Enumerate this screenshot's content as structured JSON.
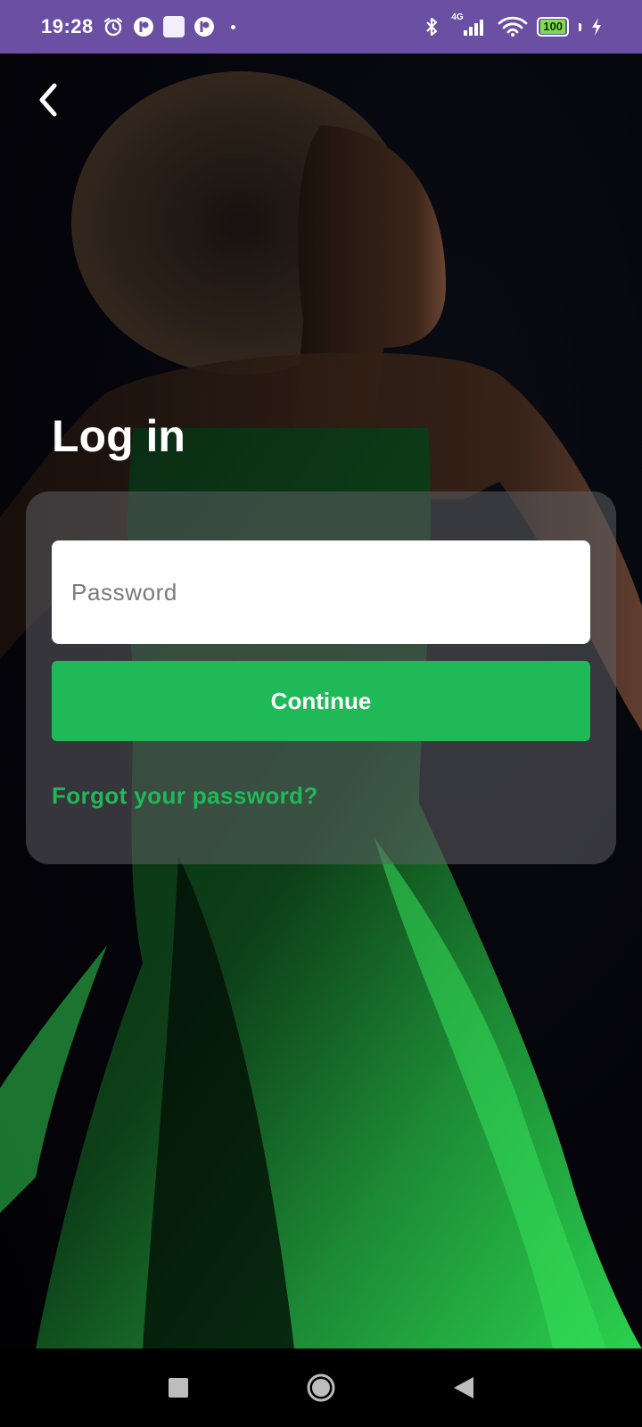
{
  "status_bar": {
    "time": "19:28",
    "battery_level": "100",
    "network_label": "4G",
    "icons": [
      "alarm-icon",
      "app-badge-icon",
      "app-square-icon",
      "app-badge-icon",
      "dot-icon",
      "bluetooth-icon",
      "signal-icon",
      "wifi-icon",
      "battery-icon",
      "charging-icon"
    ]
  },
  "header": {
    "back_icon": "chevron-left-icon",
    "title": "Log in"
  },
  "form": {
    "password_placeholder": "Password",
    "password_value": "",
    "continue_label": "Continue",
    "forgot_label": "Forgot your password?"
  },
  "nav_bar": {
    "icons": [
      "recents-square-icon",
      "home-circle-icon",
      "back-triangle-icon"
    ]
  },
  "colors": {
    "status_bar_bg": "#6a4fa3",
    "accent_green": "#1fba57",
    "card_bg": "rgba(95,95,100,0.55)",
    "background": "#04040a"
  }
}
